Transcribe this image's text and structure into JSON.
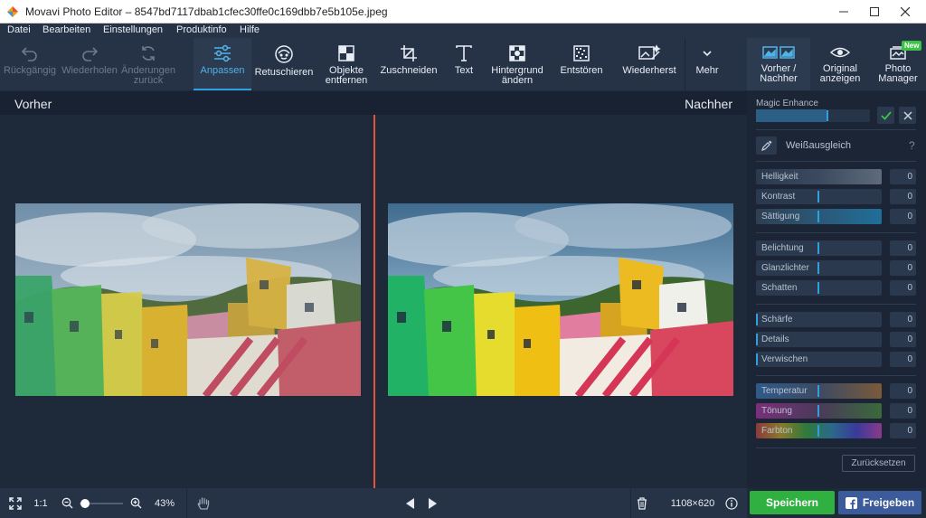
{
  "window": {
    "title": "Movavi Photo Editor – 8547bd7117dbab1cfec30ffe0c169dbb7e5b105e.jpeg"
  },
  "menu": [
    "Datei",
    "Bearbeiten",
    "Einstellungen",
    "Produktinfo",
    "Hilfe"
  ],
  "toolbar": {
    "undo": "Rückgängig",
    "redo": "Wiederholen",
    "changes_back": "Änderungen zurück",
    "adjust": "Anpassen",
    "retouch": "Retuschieren",
    "objects_remove": "Objekte entfernen",
    "crop": "Zuschneiden",
    "text": "Text",
    "background_change": "Hintergrund ändern",
    "denoise": "Entstören",
    "restore": "Wiederherst",
    "more": "Mehr"
  },
  "right_toolbar": {
    "before_after": "Vorher / Nachher",
    "show_original": "Original anzeigen",
    "photo_manager": "Photo Manager",
    "new_badge": "New"
  },
  "view": {
    "before_label": "Vorher",
    "after_label": "Nachher"
  },
  "panel": {
    "magic_enhance": "Magic Enhance",
    "magic_enhance_level": 0.62,
    "white_balance": "Weißausgleich",
    "help": "?",
    "groups": [
      [
        {
          "label": "Helligkeit",
          "value": "0"
        },
        {
          "label": "Kontrast",
          "value": "0"
        },
        {
          "label": "Sättigung",
          "value": "0"
        }
      ],
      [
        {
          "label": "Belichtung",
          "value": "0"
        },
        {
          "label": "Glanzlichter",
          "value": "0"
        },
        {
          "label": "Schatten",
          "value": "0"
        }
      ],
      [
        {
          "label": "Schärfe",
          "value": "0"
        },
        {
          "label": "Details",
          "value": "0"
        },
        {
          "label": "Verwischen",
          "value": "0"
        }
      ],
      [
        {
          "label": "Temperatur",
          "value": "0"
        },
        {
          "label": "Tönung",
          "value": "0"
        },
        {
          "label": "Farbton",
          "value": "0"
        }
      ]
    ],
    "reset": "Zurücksetzen"
  },
  "bottom": {
    "one_to_one": "1:1",
    "zoom": "43%",
    "zoom_level": 0.43,
    "dimensions": "1108×620",
    "save": "Speichern",
    "share": "Freigeben"
  },
  "colors": {
    "accent": "#2f9fe0",
    "save": "#2fb041",
    "facebook": "#3b5b9a",
    "divider": "#e5533b"
  }
}
